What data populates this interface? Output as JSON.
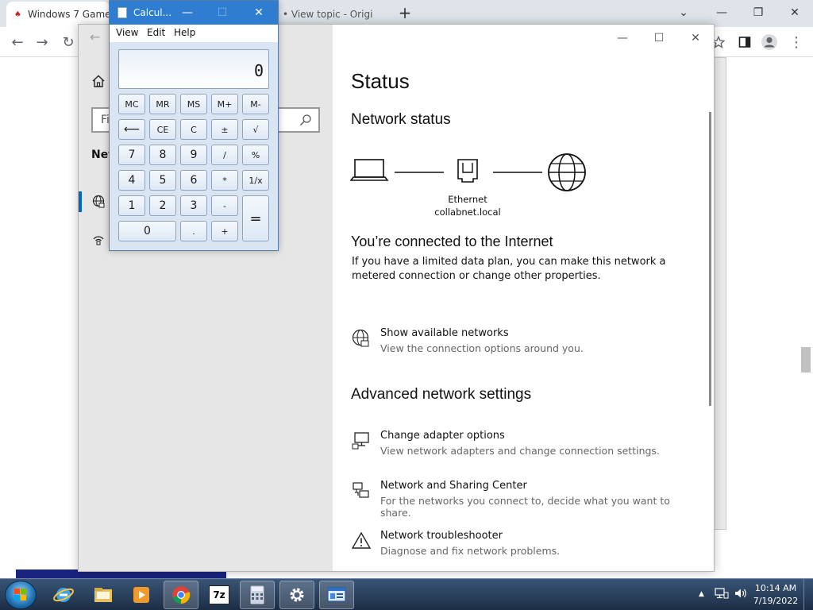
{
  "browser": {
    "tabs": [
      {
        "title": "Windows 7 Game"
      },
      {
        "title": "• View topic - Origi"
      }
    ],
    "new_tab_symbol": "+",
    "window_controls": {
      "dropdown": "⌄",
      "minimize": "—",
      "restore": "❐",
      "close": "✕"
    },
    "toolbar": {
      "back": "←",
      "forward": "→",
      "reload": "↻",
      "menu": "⋮"
    }
  },
  "calculator": {
    "title": "Calcul...",
    "window_controls": {
      "minimize": "—",
      "maximize": "☐",
      "close": "✕"
    },
    "menu": {
      "view": "View",
      "edit": "Edit",
      "help": "Help"
    },
    "display_value": "0",
    "keys": {
      "mc": "MC",
      "mr": "MR",
      "ms": "MS",
      "mplus": "M+",
      "mminus": "M-",
      "backspace": "⟵",
      "ce": "CE",
      "c": "C",
      "plusminus": "±",
      "sqrt": "√",
      "seven": "7",
      "eight": "8",
      "nine": "9",
      "divide": "/",
      "percent": "%",
      "four": "4",
      "five": "5",
      "six": "6",
      "multiply": "*",
      "reciprocal": "1/x",
      "one": "1",
      "two": "2",
      "three": "3",
      "minus": "-",
      "equals": "=",
      "zero": "0",
      "decimal": ".",
      "plus": "+"
    }
  },
  "settings": {
    "back_arrow": "←",
    "window_controls": {
      "minimize": "—",
      "maximize": "☐",
      "close": "✕"
    },
    "search_placeholder": "Fi",
    "nav_heading": "Net",
    "page_title": "Status",
    "network_status_heading": "Network status",
    "adapter": {
      "name": "Ethernet",
      "network": "collabnet.local"
    },
    "connected_heading": "You’re connected to the Internet",
    "connected_text": "If you have a limited data plan, you can make this network a metered connection or change other properties.",
    "show_networks": {
      "title": "Show available networks",
      "subtitle": "View the connection options around you."
    },
    "advanced_heading": "Advanced network settings",
    "advanced_items": [
      {
        "title": "Change adapter options",
        "subtitle": "View network adapters and change connection settings."
      },
      {
        "title": "Network and Sharing Center",
        "subtitle": "For the networks you connect to, decide what you want to share."
      },
      {
        "title": "Network troubleshooter",
        "subtitle": "Diagnose and fix network problems."
      }
    ]
  },
  "taskbar": {
    "pinned": [
      "internet-explorer",
      "file-explorer",
      "media-player",
      "chrome",
      "7zip",
      "calculator",
      "settings",
      "control-panel"
    ],
    "sevenzip_label": "7z",
    "tray": {
      "chevron": "▲"
    },
    "clock": {
      "time": "10:14 AM",
      "date": "7/19/2022"
    }
  },
  "colors": {
    "accent": "#0067c0",
    "calc_titlebar": "#2e7dd1",
    "taskbar": "#1c2d45"
  }
}
